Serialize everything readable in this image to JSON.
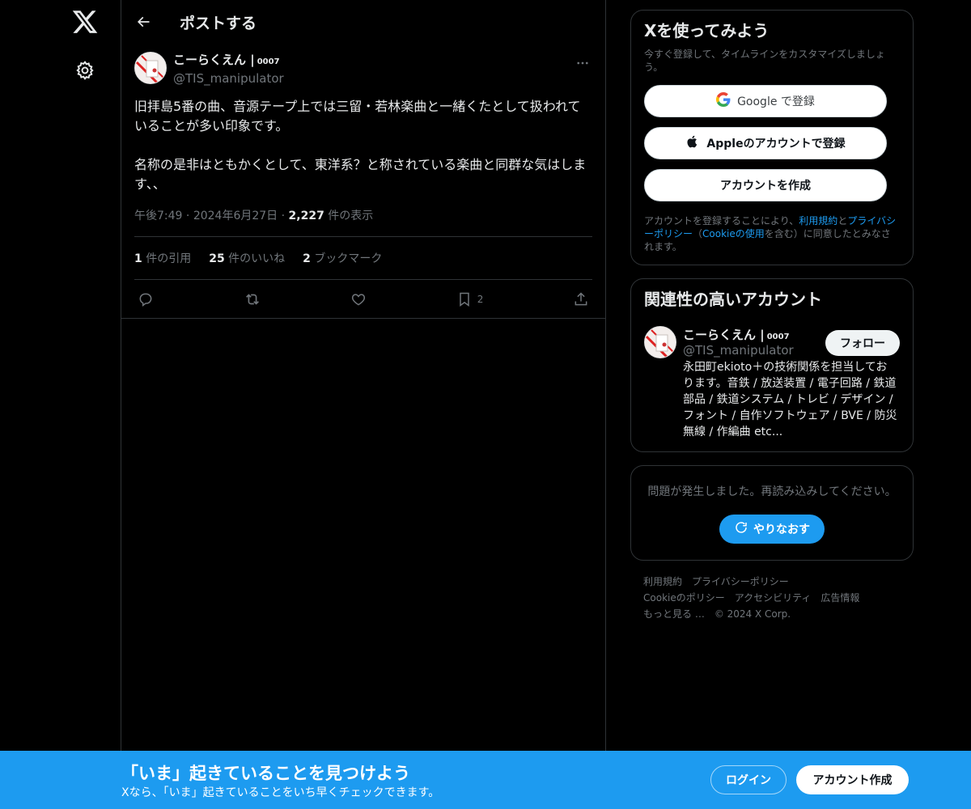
{
  "header": {
    "title": "ポストする"
  },
  "post": {
    "display_name": "こーらくえん |",
    "name_tag": "0007",
    "handle": "@TIS_manipulator",
    "text": "旧拝島5番の曲、音源テープ上では三留・若林楽曲と一緒くたとして扱われていることが多い印象です。\n\n名称の是非はともかくとして、東洋系？と称されている楽曲と同群な気はします、、",
    "time": "午後7:49",
    "date": "2024年6月27日",
    "views_count": "2,227",
    "views_label": "件の表示",
    "quotes_count": "1",
    "quotes_label": "件の引用",
    "likes_count": "25",
    "likes_label": "件のいいね",
    "bookmarks_count": "2",
    "bookmarks_label": "ブックマーク",
    "bookmark_action_count": "2"
  },
  "signup_card": {
    "title": "Xを使ってみよう",
    "subtitle": "今すぐ登録して、タイムラインをカスタマイズしましょう。",
    "google_label": "Google で登録",
    "apple_label": "Appleのアカウントで登録",
    "create_label": "アカウントを作成",
    "legal_pre": "アカウントを登録することにより、",
    "legal_terms": "利用規約",
    "legal_and": "と",
    "legal_privacy": "プライバシーポリシー",
    "legal_mid": "（",
    "legal_cookie": "Cookieの使用",
    "legal_post": "を含む）に同意したとみなされます。"
  },
  "related": {
    "title": "関連性の高いアカウント",
    "display_name": "こーらくえん |",
    "name_tag": "0007",
    "handle": "@TIS_manipulator",
    "follow_label": "フォロー",
    "bio": "永田町ekioto＋の技術関係を担当しております。音鉄 / 放送装置 / 電子回路 / 鉄道部品 / 鉄道システム / トレビ / デザイン / フォント / 自作ソフトウェア / BVE / 防災無線 / 作編曲 etc..."
  },
  "error": {
    "message": "問題が発生しました。再読み込みしてください。",
    "retry_label": "やりなおす"
  },
  "footer": {
    "terms": "利用規約",
    "privacy": "プライバシーポリシー",
    "cookie": "Cookieのポリシー",
    "accessibility": "アクセシビリティ",
    "ads": "広告情報",
    "more": "もっと見る …",
    "copyright": "© 2024 X Corp."
  },
  "banner": {
    "title": "「いま」起きていることを見つけよう",
    "subtitle": "Xなら、「いま」起きていることをいち早くチェックできます。",
    "login_label": "ログイン",
    "signup_label": "アカウント作成"
  },
  "colors": {
    "accent": "#1d9bf0",
    "background": "#000000",
    "muted": "#71767b",
    "border": "#2f3336"
  },
  "icons": [
    "x-logo-icon",
    "gear-icon",
    "back-arrow-icon",
    "more-icon",
    "reply-icon",
    "repost-icon",
    "like-icon",
    "bookmark-icon",
    "share-icon",
    "google-icon",
    "apple-icon",
    "refresh-icon"
  ]
}
